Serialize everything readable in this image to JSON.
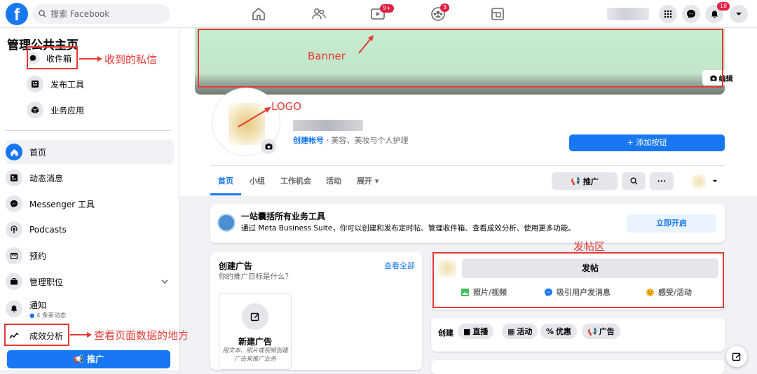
{
  "topbar": {
    "search_placeholder": "搜索 Facebook",
    "watch_badge": "9+",
    "groups_badge": "3",
    "notifications_badge": "18"
  },
  "sidebar": {
    "title": "管理公共主页",
    "tools": [
      {
        "label": "收件箱",
        "icon": "messenger-bubble-icon"
      },
      {
        "label": "发布工具",
        "icon": "publishing-tools-icon"
      },
      {
        "label": "业务应用",
        "icon": "cube-icon"
      }
    ],
    "nav": [
      {
        "label": "首页",
        "icon": "home-icon"
      },
      {
        "label": "动态消息",
        "icon": "news-feed-icon"
      },
      {
        "label": "Messenger 工具",
        "icon": "messenger-icon"
      },
      {
        "label": "Podcasts",
        "icon": "podcast-icon"
      },
      {
        "label": "预约",
        "icon": "calendar-icon"
      },
      {
        "label": "管理职位",
        "icon": "briefcase-icon"
      },
      {
        "label": "通知",
        "icon": "bell-icon",
        "sub": "4 条新动态"
      },
      {
        "label": "成效分析",
        "icon": "insights-icon"
      }
    ],
    "promote": "推广"
  },
  "annotations": {
    "inbox": "收到的私信",
    "banner": "Banner",
    "logo": "LOGO",
    "post_area": "发帖区",
    "insights": "查看页面数据的地方"
  },
  "page": {
    "edit_cover": "编辑",
    "create_account": "创建帐号",
    "category": "· 美容、美妆与个人护理",
    "add_button": "+ 添加按钮",
    "tabs": [
      "首页",
      "小组",
      "工作机会",
      "活动",
      "展开 ▾"
    ],
    "promote": "推广",
    "more": "···"
  },
  "meta_suite": {
    "title": "一站囊括所有业务工具",
    "desc": "通过 Meta Business Suite，你可以创建和发布定时帖、管理收件箱、查看成效分析、使用更多功能。",
    "button": "立即开启"
  },
  "create_ad": {
    "title": "创建广告",
    "subtitle": "你的推广目标是什么？",
    "see_all": "查看全部",
    "option_title": "新建广告",
    "option_desc": "用文本、照片或视频创建广告来推广业务"
  },
  "post": {
    "button": "发帖",
    "actions": [
      "照片/视频",
      "吸引用户发消息",
      "感受/活动"
    ]
  },
  "create_row": {
    "label": "创建",
    "chips": [
      "直播",
      "活动",
      "优惠",
      "广告"
    ]
  },
  "colors": {
    "brand": "#1877f2",
    "annotation": "#e53935",
    "banner": "#c7ecd0"
  }
}
